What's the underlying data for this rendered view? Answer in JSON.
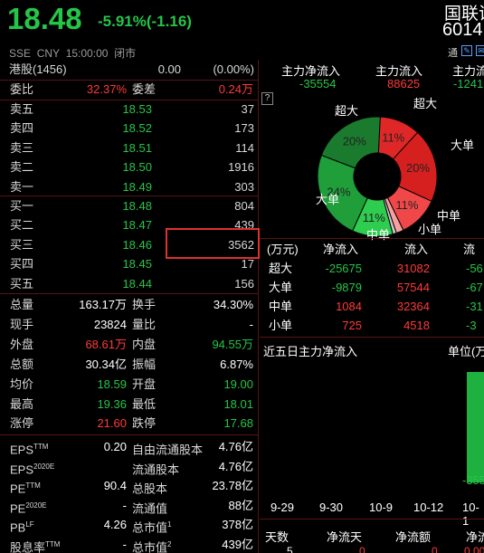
{
  "header": {
    "price": "18.48",
    "change": "-5.91%(-1.16)",
    "exchange": "SSE",
    "currency": "CNY",
    "time": "15:00:00",
    "status": "闭市",
    "name": "国联证",
    "code": "6014",
    "tools": [
      "通",
      "✎",
      "✉"
    ]
  },
  "hk_row": {
    "label": "港股(1456)",
    "value": "0.00",
    "pct": "(0.00%)"
  },
  "weibi": {
    "label1": "委比",
    "value1": "32.37%",
    "label2": "委差",
    "value2": "0.24万"
  },
  "asks": [
    {
      "label": "卖五",
      "price": "18.53",
      "vol": "37"
    },
    {
      "label": "卖四",
      "price": "18.52",
      "vol": "173"
    },
    {
      "label": "卖三",
      "price": "18.51",
      "vol": "114"
    },
    {
      "label": "卖二",
      "price": "18.50",
      "vol": "1916"
    },
    {
      "label": "卖一",
      "price": "18.49",
      "vol": "303"
    }
  ],
  "bids": [
    {
      "label": "买一",
      "price": "18.48",
      "vol": "804"
    },
    {
      "label": "买二",
      "price": "18.47",
      "vol": "439"
    },
    {
      "label": "买三",
      "price": "18.46",
      "vol": "3562"
    },
    {
      "label": "买四",
      "price": "18.45",
      "vol": "17"
    },
    {
      "label": "买五",
      "price": "18.44",
      "vol": "156"
    }
  ],
  "stats": [
    {
      "l1": "总量",
      "v1": "163.17万",
      "l2": "换手",
      "v2": "34.30%",
      "c1": "white",
      "c2": "white"
    },
    {
      "l1": "现手",
      "v1": "23824",
      "l2": "量比",
      "v2": "-",
      "c1": "white",
      "c2": "white"
    },
    {
      "l1": "外盘",
      "v1": "68.61万",
      "l2": "内盘",
      "v2": "94.55万",
      "c1": "up",
      "c2": "down"
    },
    {
      "l1": "总额",
      "v1": "30.34亿",
      "l2": "振幅",
      "v2": "6.87%",
      "c1": "white",
      "c2": "white"
    },
    {
      "l1": "均价",
      "v1": "18.59",
      "l2": "开盘",
      "v2": "19.00",
      "c1": "down",
      "c2": "down"
    },
    {
      "l1": "最高",
      "v1": "19.36",
      "l2": "最低",
      "v2": "18.01",
      "c1": "down",
      "c2": "down"
    },
    {
      "l1": "涨停",
      "v1": "21.60",
      "l2": "跌停",
      "v2": "17.68",
      "c1": "up",
      "c2": "down"
    }
  ],
  "fundamentals": [
    {
      "l1": "EPS",
      "s1": "TTM",
      "v1": "0.20",
      "l2": "自由流通股本",
      "s2": "",
      "v2": "4.76亿"
    },
    {
      "l1": "EPS",
      "s1": "2020E",
      "v1": "",
      "l2": "流通股本",
      "s2": "",
      "v2": "4.76亿"
    },
    {
      "l1": "PE",
      "s1": "TTM",
      "v1": "90.4",
      "l2": "总股本",
      "s2": "",
      "v2": "23.78亿"
    },
    {
      "l1": "PE",
      "s1": "2020E",
      "v1": "-",
      "l2": "流通值",
      "s2": "",
      "v2": "88亿"
    },
    {
      "l1": "PB",
      "s1": "LF",
      "v1": "4.26",
      "l2": "总市值",
      "s2": "1",
      "v2": "378亿"
    },
    {
      "l1": "股息率",
      "s1": "TTM",
      "v1": "-",
      "l2": "总市值",
      "s2": "2",
      "v2": "439亿"
    }
  ],
  "flow_summary": [
    {
      "head": "主力净流入",
      "value": "-35554",
      "cls": "down"
    },
    {
      "head": "主力流入",
      "value": "88625",
      "cls": "up"
    },
    {
      "head": "主力流",
      "value": "-1241",
      "cls": "down"
    }
  ],
  "pie": {
    "help_icon": "?",
    "slices": [
      {
        "label": "超大",
        "pct": "11%",
        "color": "#e02727"
      },
      {
        "label": "大单",
        "pct": "20%",
        "color": "#d61f1f"
      },
      {
        "label": "中单",
        "pct": "11%",
        "color": "#f04848"
      },
      {
        "label": "小单",
        "pct": "",
        "color": "#f7a0a0"
      },
      {
        "label": "小单",
        "pct": "",
        "color": "#c8c8c8"
      },
      {
        "label": "中单",
        "pct": "11%",
        "color": "#2ecc4f"
      },
      {
        "label": "大单",
        "pct": "24%",
        "color": "#1f9e3a"
      },
      {
        "label": "超大",
        "pct": "20%",
        "color": "#1a7a2e"
      }
    ],
    "labels": {
      "super_red": "超大",
      "big_red": "大单",
      "mid_red": "中单",
      "small_red": "小单",
      "super_green": "超大",
      "big_green": "大单",
      "mid_green": "中单"
    }
  },
  "flow_table": {
    "headers": [
      "(万元)",
      "净流入",
      "流入",
      "流"
    ],
    "rows": [
      {
        "label": "超大",
        "net": "-25675",
        "in": "31082",
        "out": "-56",
        "net_cls": "down"
      },
      {
        "label": "大单",
        "net": "-9879",
        "in": "57544",
        "out": "-67",
        "net_cls": "down"
      },
      {
        "label": "中单",
        "net": "1084",
        "in": "32364",
        "out": "-31",
        "net_cls": "up"
      },
      {
        "label": "小单",
        "net": "725",
        "in": "4518",
        "out": "-3",
        "net_cls": "up"
      }
    ]
  },
  "five_day": {
    "title": "近五日主力净流入",
    "unit": "单位(万",
    "bar_label": "-355",
    "dates": [
      "9-29",
      "9-30",
      "10-9",
      "10-12",
      "10-1"
    ]
  },
  "days_table": {
    "headers": [
      "天数",
      "净流天",
      "净流额",
      "净流"
    ],
    "row": [
      "5",
      "0",
      "0",
      "0.00"
    ]
  }
}
